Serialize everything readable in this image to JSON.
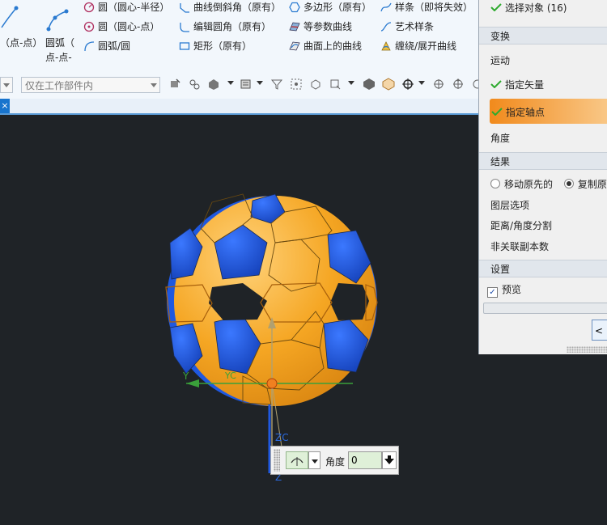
{
  "ribbon": {
    "left_labels": [
      "（点-点）",
      "圆弧（",
      "点-点-"
    ],
    "col1": [
      "圆（圆心-半径）",
      "圆（圆心-点）",
      "圆弧/圆"
    ],
    "col2": [
      "曲线倒斜角（原有）",
      "编辑圆角（原有）",
      "矩形（原有）"
    ],
    "col3": [
      "多边形（原有）",
      "等参数曲线",
      "曲面上的曲线"
    ],
    "col4": [
      "样条（即将失效）",
      "艺术样条",
      "缠绕/展开曲线"
    ]
  },
  "toolbar": {
    "scope_combo": "仅在工作部件内"
  },
  "tab": {
    "close": "×"
  },
  "panel": {
    "select_objects": "选择对象 (16)",
    "sections": {
      "transform": "变换",
      "result": "结果",
      "settings": "设置"
    },
    "motion": "运动",
    "specify_vector": "指定矢量",
    "specify_pivot": "指定轴点",
    "angle": "角度",
    "move_original": "移动原先的",
    "copy_original": "复制原",
    "layer_options": "图层选项",
    "distance_angle_split": "距离/角度分割",
    "non_assoc_copies": "非关联副本数",
    "preview": "预览",
    "ok_button": "< 确"
  },
  "viewport": {
    "axis_y": "Y",
    "axis_yc": "YC",
    "axis_zc": "ZC",
    "axis_z": "Z"
  },
  "mini_toolbar": {
    "angle_label": "角度",
    "angle_value": "0"
  },
  "colors": {
    "ball_orange": "#f5a623",
    "ball_blue": "#1f58e0",
    "highlight": "#f18a1c",
    "background": "#1f2327"
  }
}
